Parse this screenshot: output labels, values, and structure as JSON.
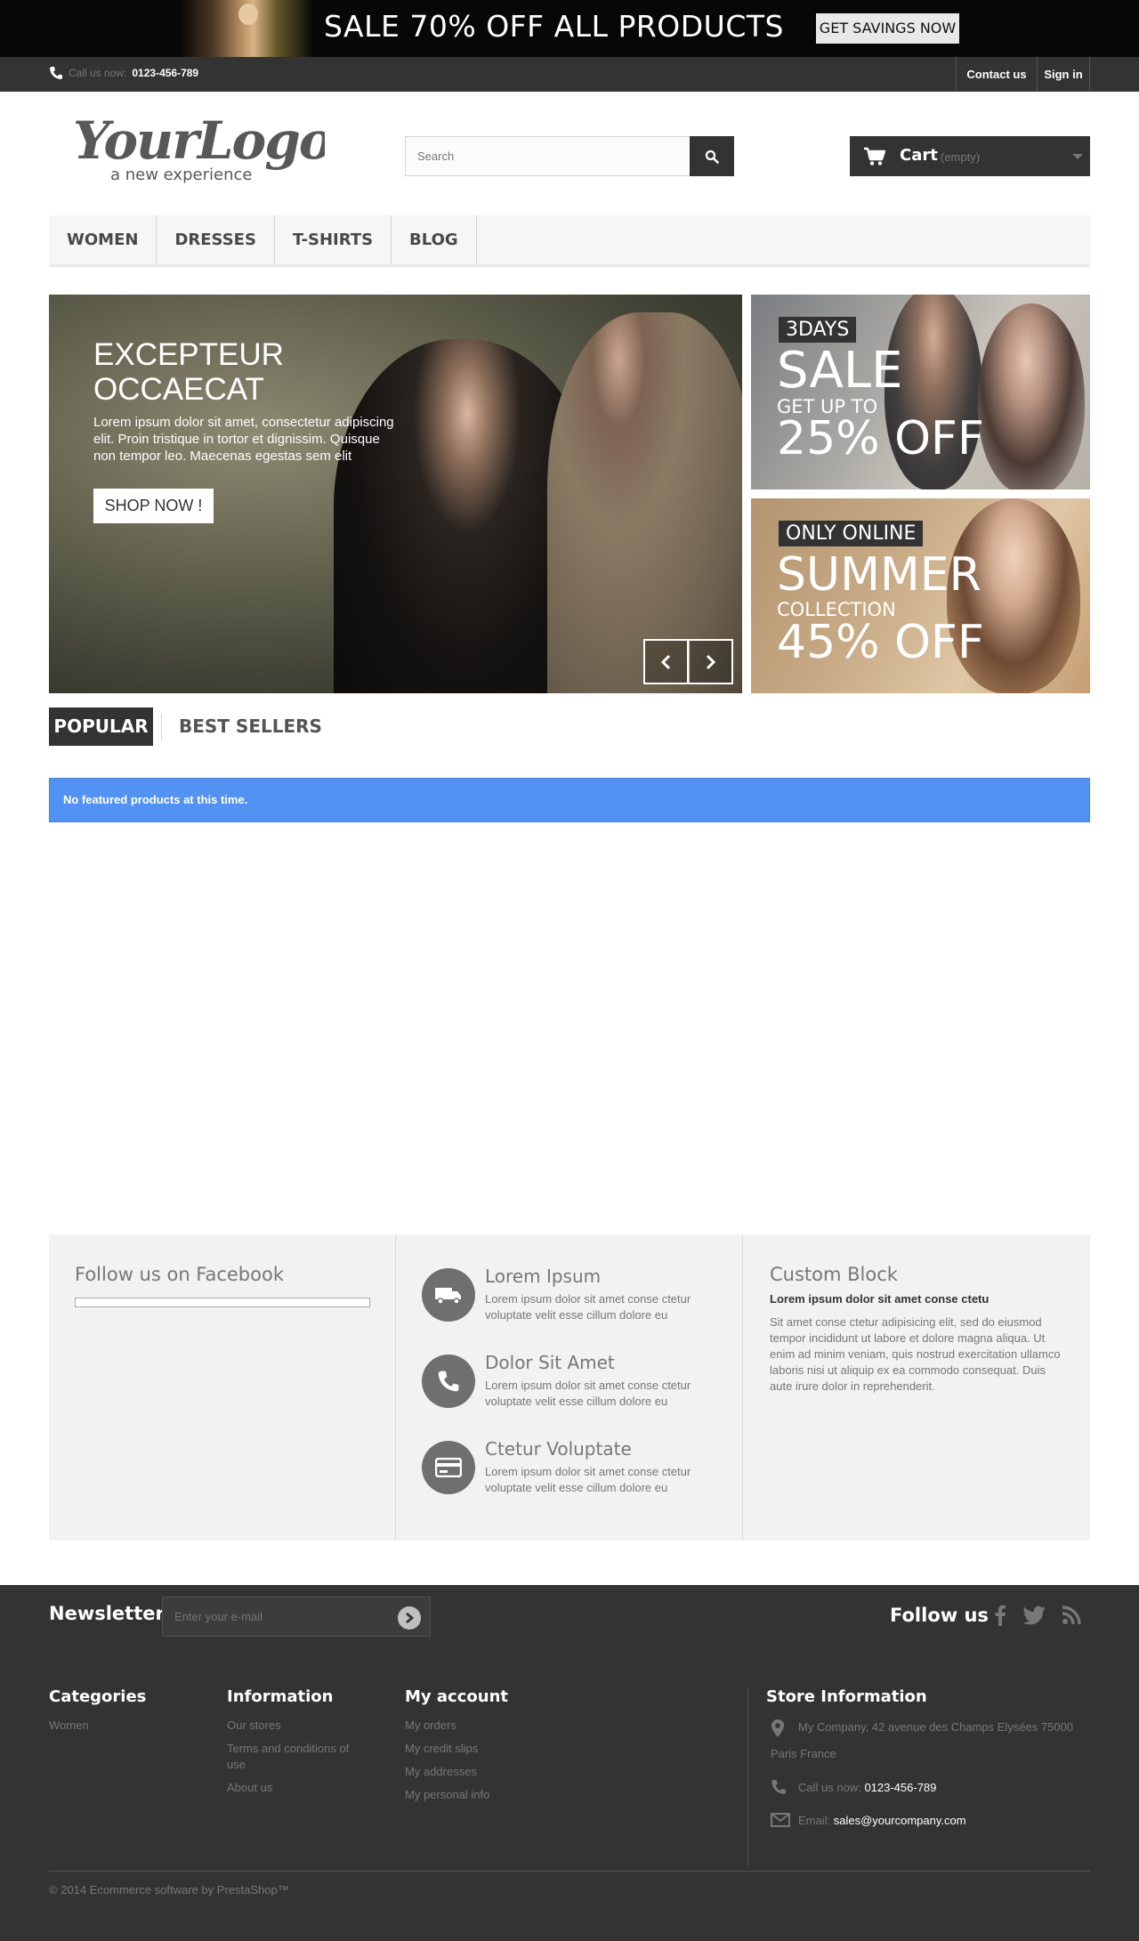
{
  "banner": {
    "text": "SALE 70% OFF ALL PRODUCTS",
    "button": "GET SAVINGS NOW"
  },
  "topbar": {
    "call_label": "Call us now:",
    "phone": "0123-456-789",
    "contact": "Contact us",
    "signin": "Sign in"
  },
  "logo": {
    "name": "YourLogo",
    "tagline": "a new experience"
  },
  "search": {
    "placeholder": "Search"
  },
  "cart": {
    "label": "Cart",
    "status": "(empty)"
  },
  "menu": [
    "WOMEN",
    "DRESSES",
    "T-SHIRTS",
    "BLOG"
  ],
  "hero": {
    "title": "EXCEPTEUR OCCAECAT",
    "text": "Lorem ipsum dolor sit amet, consectetur adipiscing elit. Proin tristique in tortor et dignissim. Quisque non tempor leo. Maecenas egestas sem elit",
    "button": "SHOP NOW !"
  },
  "promo1": {
    "tag": "3DAYS",
    "line1": "SALE",
    "line2": "GET UP TO",
    "line3": "25% OFF"
  },
  "promo2": {
    "tag": "ONLY ONLINE",
    "line1": "SUMMER",
    "line2": "COLLECTION",
    "line3": "45% OFF"
  },
  "tabs": {
    "popular": "POPULAR",
    "bestsellers": "BEST SELLERS"
  },
  "alert": "No featured products at this time.",
  "facebook": {
    "title": "Follow us on Facebook"
  },
  "features": [
    {
      "title": "Lorem Ipsum",
      "text": "Lorem ipsum dolor sit amet conse ctetur voluptate velit esse cillum dolore eu",
      "icon": "truck-icon"
    },
    {
      "title": "Dolor Sit Amet",
      "text": "Lorem ipsum dolor sit amet conse ctetur voluptate velit esse cillum dolore eu",
      "icon": "phone-icon"
    },
    {
      "title": "Ctetur Voluptate",
      "text": "Lorem ipsum dolor sit amet conse ctetur voluptate velit esse cillum dolore eu",
      "icon": "credit-card-icon"
    }
  ],
  "custom_block": {
    "title": "Custom Block",
    "subtitle": "Lorem ipsum dolor sit amet conse ctetu",
    "text": "Sit amet conse ctetur adipisicing elit, sed do eiusmod tempor incididunt ut labore et dolore magna aliqua. Ut enim ad minim veniam, quis nostrud exercitation ullamco laboris nisi ut aliquip ex ea commodo consequat. Duis aute irure dolor in reprehenderit."
  },
  "newsletter": {
    "label": "Newsletter",
    "placeholder": "Enter your e-mail"
  },
  "follow": {
    "label": "Follow us"
  },
  "footer": {
    "categories": {
      "title": "Categories",
      "items": [
        "Women"
      ]
    },
    "information": {
      "title": "Information",
      "items": [
        "Our stores",
        "Terms and conditions of use",
        "About us"
      ]
    },
    "account": {
      "title": "My account",
      "items": [
        "My orders",
        "My credit slips",
        "My addresses",
        "My personal info"
      ]
    },
    "store": {
      "title": "Store Information",
      "address": "My Company, 42 avenue des Champs Elysées 75000 Paris France",
      "call_label": "Call us now:",
      "phone": "0123-456-789",
      "email_label": "Email:",
      "email": "sales@yourcompany.com"
    },
    "copyright": "© 2014 Ecommerce software by PrestaShop™"
  },
  "colors": {
    "dark": "#333333",
    "alert_blue": "#5192f3",
    "footer_block_bg": "#f2f2f2"
  }
}
